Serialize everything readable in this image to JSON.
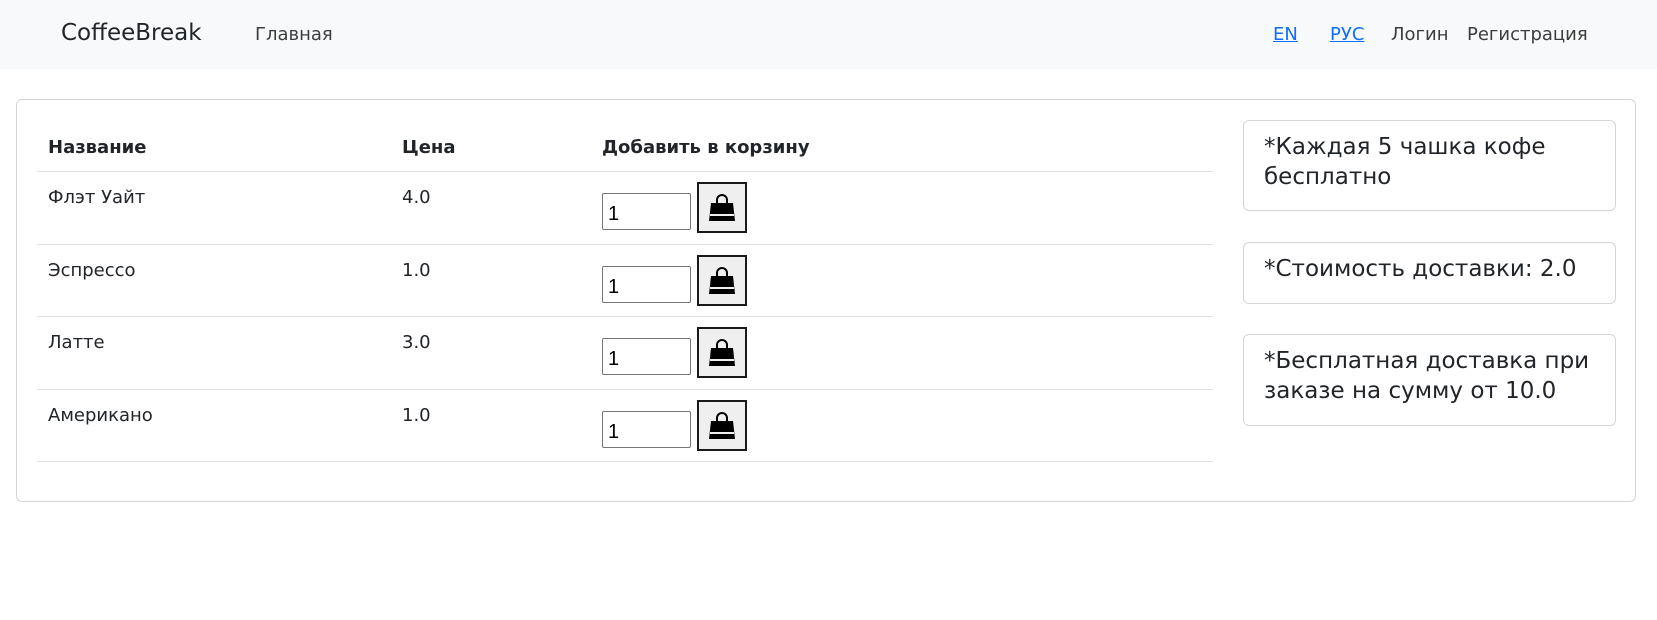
{
  "navbar": {
    "brand": "CoffeeBreak",
    "home": "Главная",
    "lang_en": "EN",
    "lang_ru": "РУС",
    "login": "Логин",
    "register": "Регистрация"
  },
  "table": {
    "headers": {
      "name": "Название",
      "price": "Цена",
      "add": "Добавить в корзину"
    },
    "rows": [
      {
        "name": "Флэт Уайт",
        "price": "4.0",
        "qty": "1"
      },
      {
        "name": "Эспрессо",
        "price": "1.0",
        "qty": "1"
      },
      {
        "name": "Латте",
        "price": "3.0",
        "qty": "1"
      },
      {
        "name": "Американо",
        "price": "1.0",
        "qty": "1"
      }
    ],
    "cart_icon": "shopping-bag-icon"
  },
  "notes": [
    "*Каждая 5 чашка кофе бесплатно",
    "*Стоимость доставки: 2.0",
    "*Бесплатная доставка при заказе на сумму от 10.0"
  ],
  "colors": {
    "navbar_bg": "#f8f9fa",
    "link": "#0d6efd",
    "text": "#212529",
    "border": "#d3d6d9"
  }
}
